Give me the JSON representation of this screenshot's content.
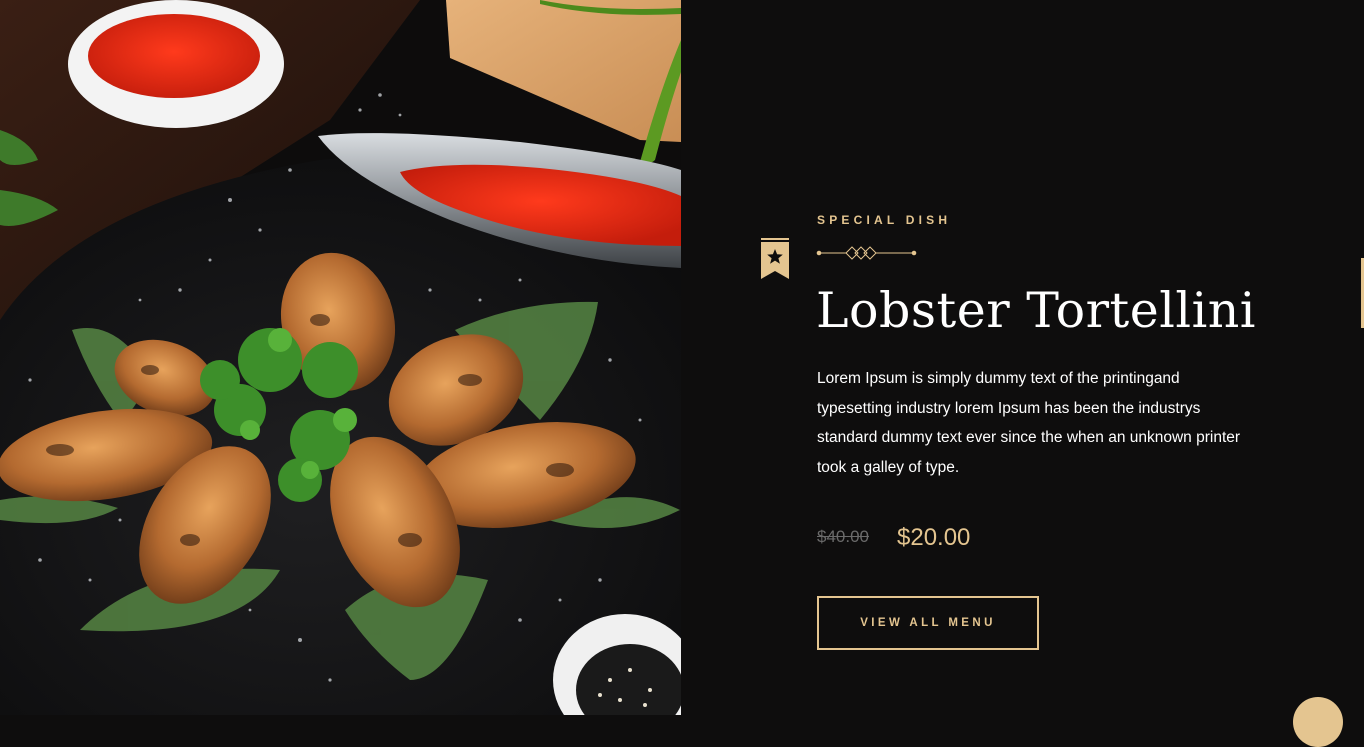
{
  "special": {
    "subtitle": "SPECIAL DISH",
    "title": "Lobster Tortellini",
    "description": "Lorem Ipsum is simply dummy text of the printingand typesetting industry lorem Ipsum has been the industrys standard dummy text ever since the when an unknown printer took a galley of type.",
    "price_old": "$40.00",
    "price_new": "$20.00",
    "button_label": "VIEW ALL MENU"
  },
  "icons": {
    "badge": "star-bookmark-icon",
    "separator": "diamond-separator-icon",
    "back_to_top": "back-to-top-button"
  },
  "colors": {
    "background": "#0e0d0d",
    "accent": "#e4c590",
    "text": "#ffffff",
    "muted": "#6a6a6a"
  }
}
